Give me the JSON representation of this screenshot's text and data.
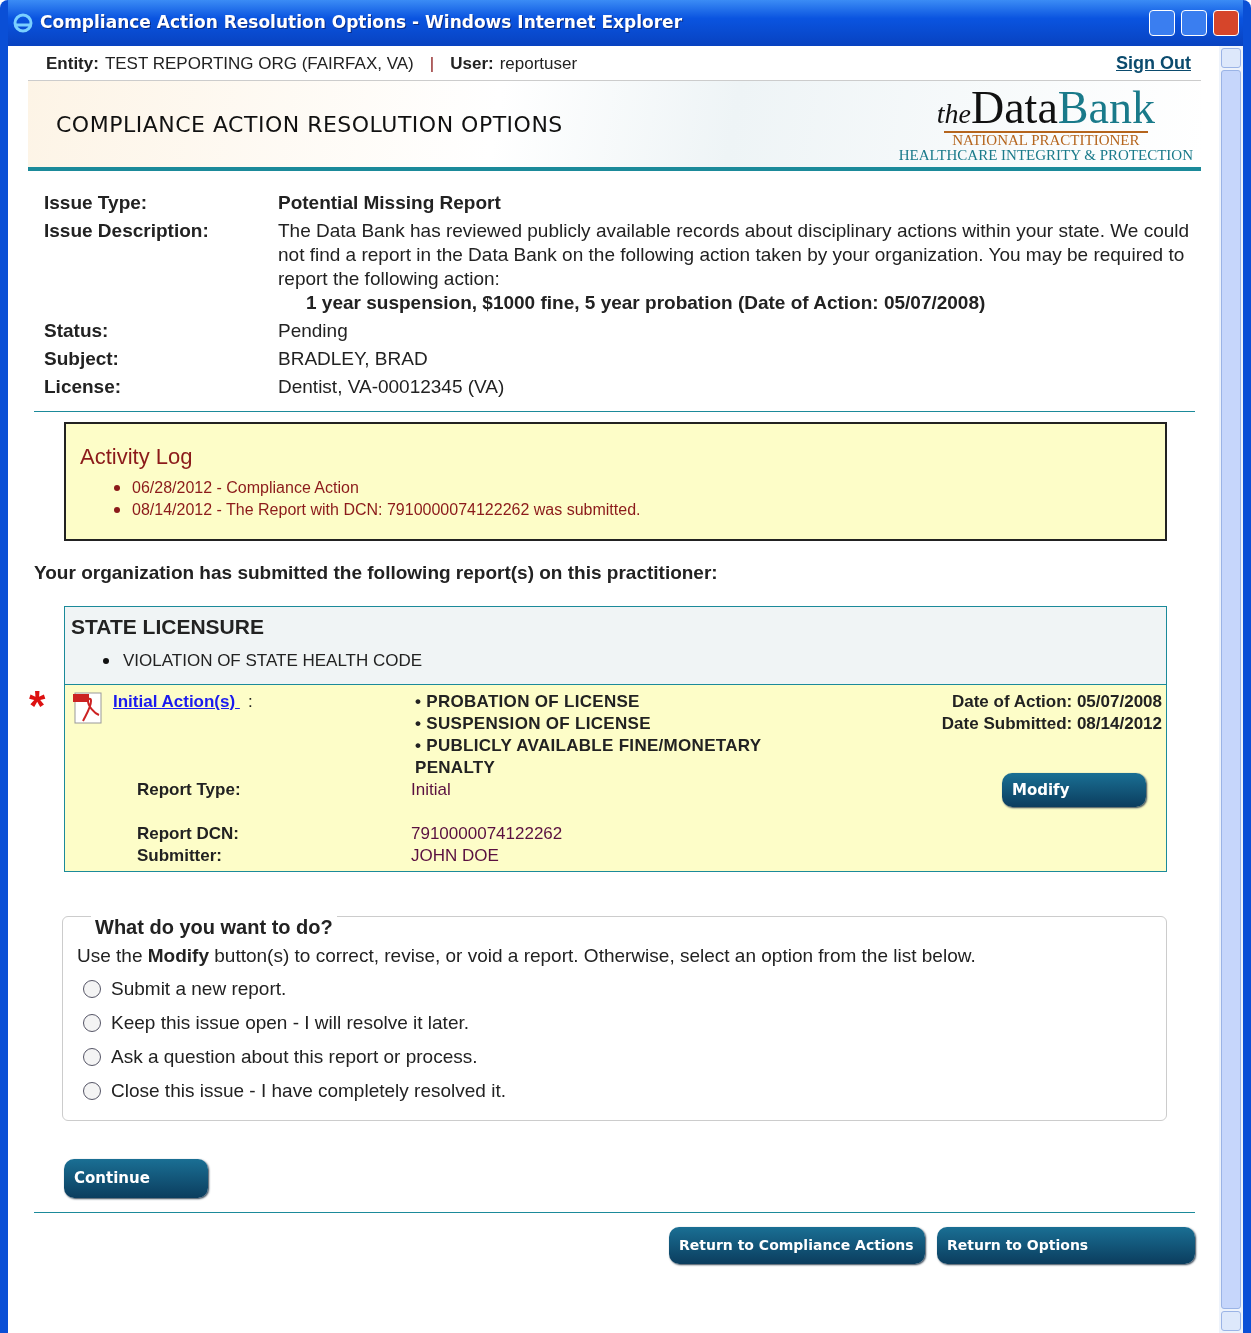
{
  "window": {
    "title": "Compliance Action Resolution Options - Windows Internet Explorer"
  },
  "header": {
    "entity_label": "Entity:",
    "entity": "TEST REPORTING ORG (FAIRFAX, VA)",
    "separator": "|",
    "user_label": "User:",
    "user": "reportuser",
    "sign_out": "Sign Out"
  },
  "page_title": "COMPLIANCE ACTION RESOLUTION OPTIONS",
  "logo": {
    "the": "the",
    "data": "Data",
    "bank": "Bank",
    "line1": "NATIONAL PRACTITIONER",
    "line2": "HEALTHCARE INTEGRITY & PROTECTION"
  },
  "issue": {
    "fields": [
      {
        "label": "Issue Type:",
        "value": "Potential Missing Report",
        "bold": true
      },
      {
        "label": "Issue Description:",
        "value": "The Data Bank has reviewed publicly available records about disciplinary actions within your state. We could not find a report in the Data Bank on the following action taken by your organization. You may be required to report the following action:",
        "detail": "1 year suspension, $1000 fine, 5 year probation (Date of Action: 05/07/2008)",
        "bold": false
      },
      {
        "label": "Status:",
        "value": "Pending",
        "bold": false
      },
      {
        "label": "Subject:",
        "value": "BRADLEY, BRAD",
        "bold": false
      },
      {
        "label": "License:",
        "value": "Dentist, VA-00012345 (VA)",
        "bold": false
      }
    ]
  },
  "activity_log": {
    "title": "Activity Log",
    "entries": [
      "06/28/2012 - Compliance Action",
      "08/14/2012 - The Report with DCN: 7910000074122262 was submitted."
    ]
  },
  "submitted_heading": "Your organization has submitted the following report(s) on this practitioner:",
  "report": {
    "category": "STATE LICENSURE",
    "bases": [
      "VIOLATION OF STATE HEALTH CODE"
    ],
    "required_mark": "*",
    "link": "Initial Action(s) ",
    "link_suffix": ":",
    "actions": [
      "• PROBATION OF LICENSE",
      "• SUSPENSION OF LICENSE",
      "• PUBLICLY AVAILABLE FINE/MONETARY PENALTY"
    ],
    "dates": [
      "Date of Action: 05/07/2008",
      "Date Submitted: 08/14/2012"
    ],
    "fields": [
      {
        "label": "Report Type:",
        "value": "Initial"
      },
      {
        "label": "Report DCN:",
        "value": "7910000074122262"
      },
      {
        "label": "Submitter:",
        "value": "JOHN DOE"
      }
    ],
    "modify_button": "Modify"
  },
  "options": {
    "legend": "What do you want to do?",
    "intro": "Use the **Modify** button(s) to correct, revise, or void a report. Otherwise, select an option from the list below.",
    "choices": [
      {
        "label": "Submit a new report.",
        "selected": false
      },
      {
        "label": "Keep this issue open - I will resolve it later.",
        "selected": false
      },
      {
        "label": "Ask a question about this report or process.",
        "selected": false
      },
      {
        "label": "Close this issue - I have completely resolved it.",
        "selected": false
      }
    ]
  },
  "continue_button": "Continue",
  "footer_buttons": [
    "Return to Compliance Actions",
    "Return to Options"
  ]
}
